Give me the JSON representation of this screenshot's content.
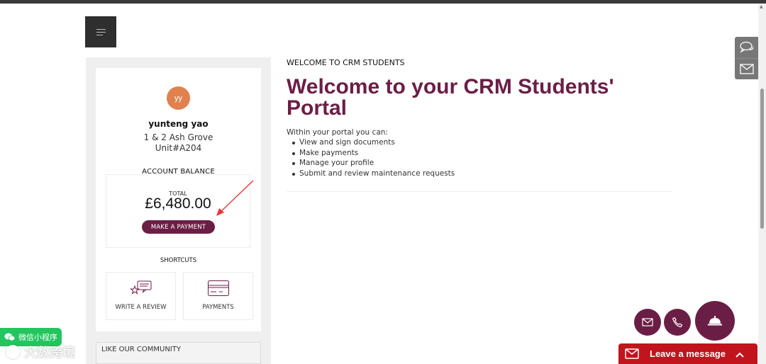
{
  "profile": {
    "initials": "yy",
    "name": "yunteng yao",
    "address_line1": "1 & 2 Ash Grove",
    "address_line2": "Unit#A204"
  },
  "account": {
    "heading": "ACCOUNT BALANCE",
    "total_label": "TOTAL",
    "total_amount": "£6,480.00",
    "pay_button": "MAKE A PAYMENT"
  },
  "shortcuts": {
    "heading": "SHORTCUTS",
    "items": [
      {
        "label": "WRITE A REVIEW",
        "icon": "review-icon"
      },
      {
        "label": "PAYMENTS",
        "icon": "card-icon"
      }
    ]
  },
  "community": {
    "label": "LIKE OUR COMMUNITY"
  },
  "main": {
    "kicker": "WELCOME TO CRM STUDENTS",
    "title": "Welcome to your CRM Students' Portal",
    "intro": "Within your portal you can:",
    "bullets": [
      "View and sign documents",
      "Make payments",
      "Manage your profile",
      "Submit and review maintenance requests"
    ]
  },
  "widgets": {
    "leave_message": "Leave a message",
    "wechat_label": "微信小程序",
    "watermark_text": "大数跨境"
  },
  "colors": {
    "brand": "#6b1e45",
    "avatar": "#e0814f",
    "leave_message": "#c1141d",
    "wechat": "#22c55e"
  }
}
